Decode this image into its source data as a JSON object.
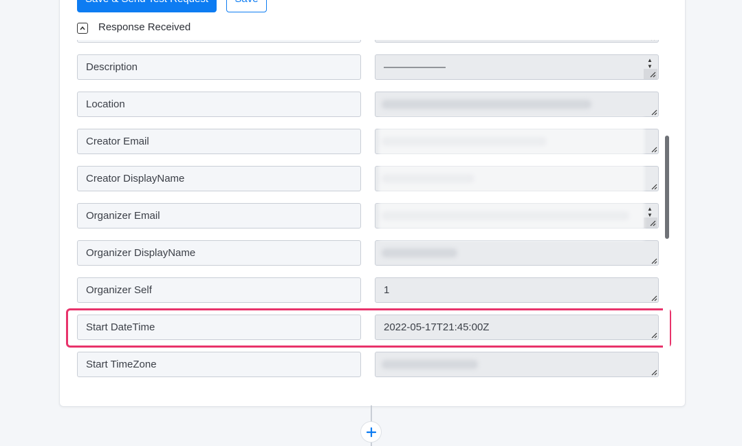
{
  "actions": {
    "save_send_label": "Save & Send Test Request",
    "save_label": "Save"
  },
  "section": {
    "title": "Response Received"
  },
  "fields": [
    {
      "label": "",
      "value": ""
    },
    {
      "label": "Description",
      "value": "——————"
    },
    {
      "label": "Location",
      "value": ""
    },
    {
      "label": "Creator Email",
      "value": ""
    },
    {
      "label": "Creator DisplayName",
      "value": ""
    },
    {
      "label": "Organizer Email",
      "value": ""
    },
    {
      "label": "Organizer DisplayName",
      "value": ""
    },
    {
      "label": "Organizer Self",
      "value": "1"
    },
    {
      "label": "Start DateTime",
      "value": "2022-05-17T21:45:00Z"
    },
    {
      "label": "Start TimeZone",
      "value": ""
    }
  ],
  "icons": {
    "collapse": "chevron-up-icon",
    "resize": "resize-handle-icon",
    "add": "plus-icon"
  },
  "colors": {
    "primary": "#0d7cf2",
    "highlight": "#e8336b"
  }
}
